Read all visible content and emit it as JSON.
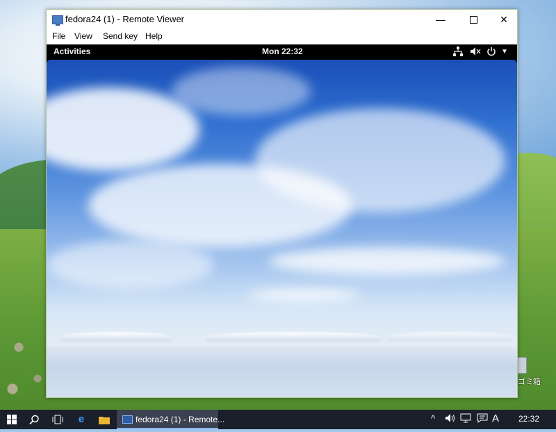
{
  "window": {
    "title": "fedora24 (1) - Remote Viewer",
    "controls": {
      "minimize": "—",
      "maximize": "",
      "close": "✕"
    }
  },
  "menu": {
    "file": "File",
    "view": "View",
    "send_key": "Send key",
    "help": "Help"
  },
  "guest": {
    "activities": "Activities",
    "clock": "Mon 22:32",
    "icons": {
      "network": "network-icon",
      "volume": "volume-icon",
      "power": "power-icon",
      "menu": "chevron-down-icon"
    }
  },
  "desktop": {
    "partial_label": "ゴミ箱"
  },
  "taskbar": {
    "task_label": "fedora24 (1) - Remote...",
    "clock": "22:32",
    "ime": "A",
    "icons": [
      "windows-start-icon",
      "search-icon",
      "task-view-icon",
      "edge-icon",
      "file-explorer-icon"
    ]
  }
}
